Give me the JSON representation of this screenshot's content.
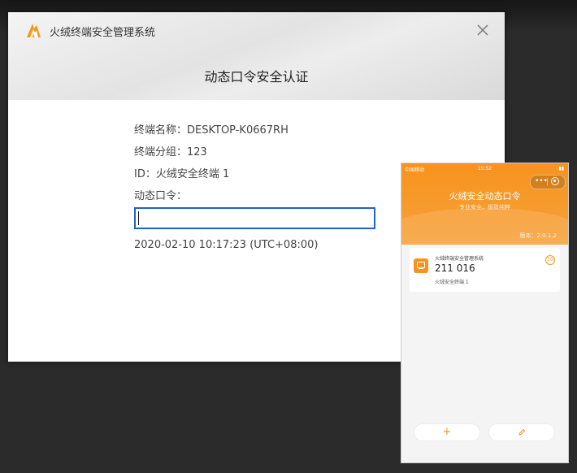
{
  "dialog": {
    "app_title": "火绒终端安全管理系统",
    "heading": "动态口令安全认证",
    "terminal_name": {
      "label": "终端名称：",
      "value": "DESKTOP-K0667RH"
    },
    "terminal_group": {
      "label": "终端分组：",
      "value": "123"
    },
    "terminal_id": {
      "label": "ID：",
      "value": "火绒安全终端 1"
    },
    "code_label": "动态口令：",
    "code_value": "",
    "timestamp": "2020-02-10 10:17:23 (UTC+08:00)",
    "close_icon": "close-icon",
    "logo_icon": "huorong-logo-icon"
  },
  "phone": {
    "status_left": "中国移动",
    "status_time": "15:52",
    "title": "火绒安全动态口令",
    "subtitle": "专业安全、极致纯粹",
    "version": "版本：2.0.1.2",
    "token": {
      "system": "火绒终端安全管理系统",
      "code": "211 016",
      "name": "火绒安全终端 1",
      "countdown": "10"
    },
    "add_label": "+",
    "accent_color": "#f7931e"
  }
}
